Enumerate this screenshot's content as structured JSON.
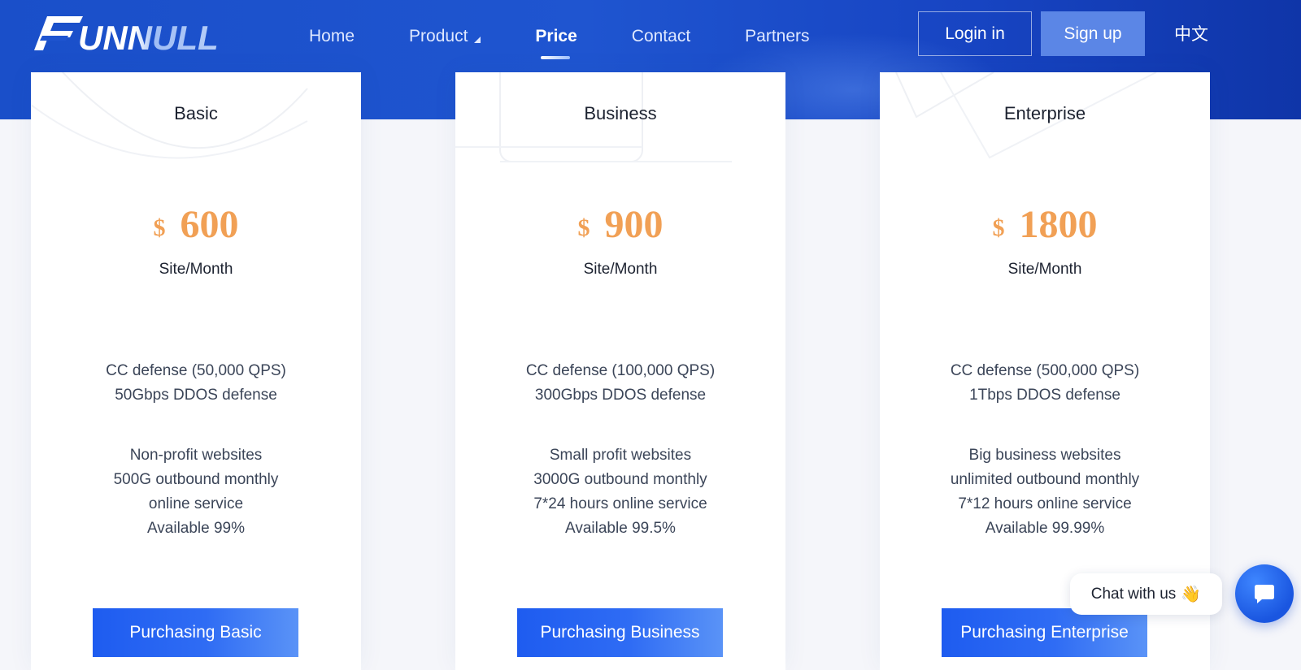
{
  "header": {
    "logo_text": "FUNNULL",
    "nav": [
      {
        "label": "Home",
        "active": false
      },
      {
        "label": "Product",
        "active": false,
        "has_dropdown": true
      },
      {
        "label": "Price",
        "active": true
      },
      {
        "label": "Contact",
        "active": false
      },
      {
        "label": "Partners",
        "active": false
      }
    ],
    "login_label": "Login in",
    "signup_label": "Sign up",
    "language_label": "中文"
  },
  "plans": [
    {
      "name": "Basic",
      "currency": "$",
      "price": "600",
      "unit": "Site/Month",
      "features_1": [
        "CC defense (50,000 QPS)",
        "50Gbps DDOS defense"
      ],
      "features_2": [
        "Non-profit websites",
        "500G outbound monthly",
        "online service",
        "Available 99%"
      ],
      "button_label": "Purchasing Basic"
    },
    {
      "name": "Business",
      "currency": "$",
      "price": "900",
      "unit": "Site/Month",
      "features_1": [
        "CC defense (100,000 QPS)",
        "300Gbps DDOS defense"
      ],
      "features_2": [
        "Small profit websites",
        "3000G outbound monthly",
        "7*24 hours online service",
        "Available 99.5%"
      ],
      "button_label": "Purchasing Business"
    },
    {
      "name": "Enterprise",
      "currency": "$",
      "price": "1800",
      "unit": "Site/Month",
      "features_1": [
        "CC defense (500,000 QPS)",
        "1Tbps DDOS defense"
      ],
      "features_2": [
        "Big business websites",
        "unlimited outbound monthly",
        "7*12 hours online service",
        "Available 99.99%"
      ],
      "button_label": "Purchasing Enterprise"
    }
  ],
  "chat": {
    "bubble_label": "Chat with us",
    "bubble_emoji": "👋",
    "icon": "chat-icon"
  },
  "colors": {
    "brand_blue": "#1f55d0",
    "price_orange": "#f1a055",
    "button_blue": "#1e5cf0"
  }
}
